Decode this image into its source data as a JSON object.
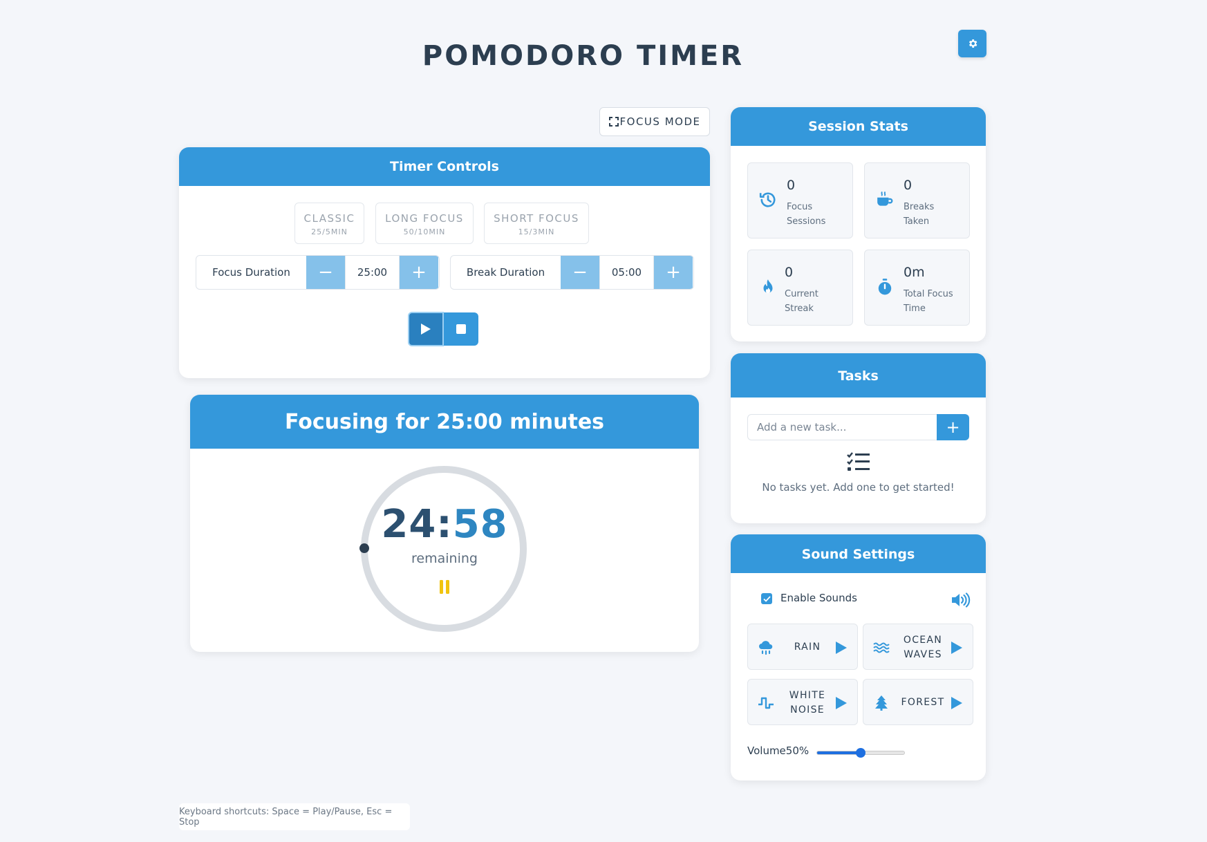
{
  "header": {
    "title": "POMODORO TIMER"
  },
  "focus_mode": {
    "label": "FOCUS MODE"
  },
  "timer_controls": {
    "title": "Timer Controls",
    "presets": [
      {
        "name": "CLASSIC",
        "sub": "25/5MIN"
      },
      {
        "name": "LONG FOCUS",
        "sub": "50/10MIN"
      },
      {
        "name": "SHORT FOCUS",
        "sub": "15/3MIN"
      }
    ],
    "focus_duration": {
      "label": "Focus Duration",
      "value": "25:00",
      "minus": "−",
      "plus": "+"
    },
    "break_duration": {
      "label": "Break Duration",
      "value": "05:00",
      "minus": "−",
      "plus": "+"
    }
  },
  "timer": {
    "title": "Focusing for 25:00 minutes",
    "minutes": "24",
    "colon": ":",
    "seconds": "58",
    "remaining_label": "remaining",
    "progress": 0.0013
  },
  "stats": {
    "title": "Session Stats",
    "items": [
      {
        "value": "0",
        "label": "Focus Sessions",
        "icon": "history-icon"
      },
      {
        "value": "0",
        "label": "Breaks Taken",
        "icon": "coffee-icon"
      },
      {
        "value": "0",
        "label": "Current Streak",
        "icon": "fire-icon"
      },
      {
        "value": "0m",
        "label": "Total Focus Time",
        "icon": "stopwatch-icon"
      }
    ]
  },
  "tasks": {
    "title": "Tasks",
    "placeholder": "Add a new task...",
    "add_label": "+",
    "empty_text": "No tasks yet. Add one to get started!"
  },
  "sound": {
    "title": "Sound Settings",
    "enable_label": "Enable Sounds",
    "enabled": true,
    "items": [
      {
        "name": "RAIN",
        "icon": "rain-cloud-icon"
      },
      {
        "name": "OCEAN WAVES",
        "icon": "water-icon"
      },
      {
        "name": "WHITE NOISE",
        "icon": "wave-square-icon"
      },
      {
        "name": "FOREST",
        "icon": "tree-icon"
      }
    ],
    "volume_label": "Volume",
    "volume_text": "50%",
    "volume": 50
  },
  "footer": {
    "shortcuts": "Keyboard shortcuts: Space = Play/Pause, Esc = Stop"
  },
  "colors": {
    "accent": "#3498db",
    "accent_light": "#85c1ea",
    "title": "#2c3e50",
    "pause": "#f1c40f"
  }
}
